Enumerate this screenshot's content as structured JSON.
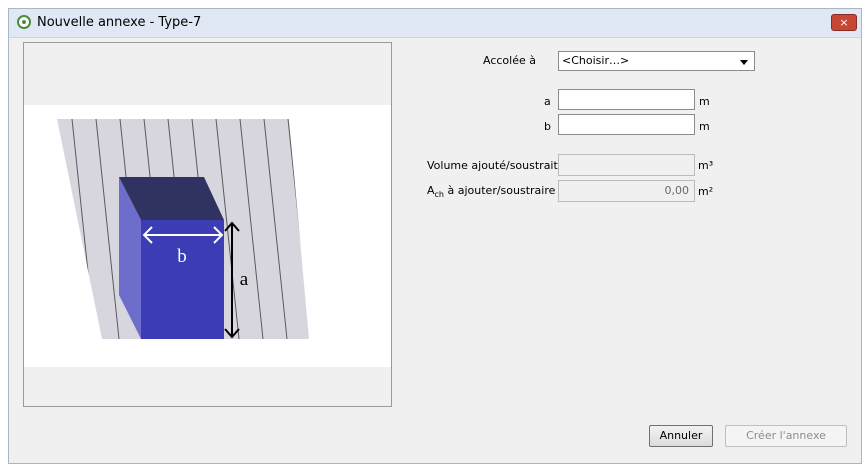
{
  "window": {
    "title": "Nouvelle annexe - Type-7",
    "close": "×"
  },
  "illustration": {
    "width_label": "b",
    "height_label": "a"
  },
  "form": {
    "attached_label": "Accolée à",
    "attached_selected": "<Choisir…>",
    "a_label": "a",
    "a_value": "",
    "a_unit": "m",
    "b_label": "b",
    "b_value": "",
    "b_unit": "m",
    "volume_label": "Volume ajouté/soustrait",
    "volume_value": "",
    "volume_unit": "m³",
    "ach_label_main": "A",
    "ach_label_sub": "ch",
    "ach_label_rest": " à ajouter/soustraire",
    "ach_value": "0,00",
    "ach_unit": "m²"
  },
  "buttons": {
    "cancel": "Annuler",
    "create": "Créer l'annexe"
  },
  "colors": {
    "box_front": "#3c3cb4",
    "box_side": "#6d6ecb",
    "box_top": "#303262",
    "hatch": "#d7d6de"
  }
}
